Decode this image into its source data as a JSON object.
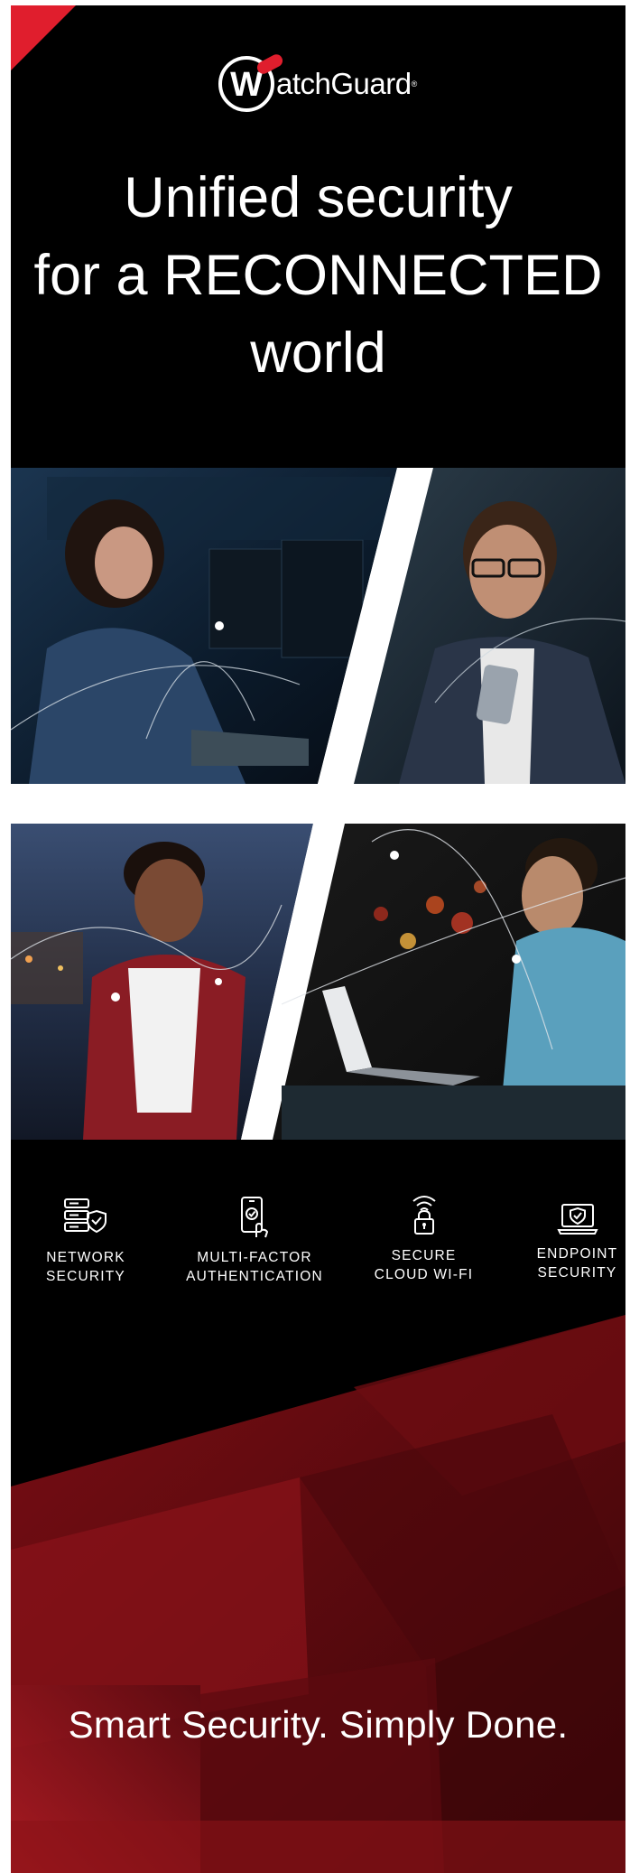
{
  "brand": {
    "logo_letter": "W",
    "logo_text": "atchGuard",
    "logo_mark": "®",
    "accent_color": "#e01e2d"
  },
  "headline": {
    "line1": "Unified security",
    "line2": "for a RECONNECTED",
    "line3": "world"
  },
  "photos": [
    {
      "icon": "woman-at-monitors-photo"
    },
    {
      "icon": "man-with-phone-photo"
    },
    {
      "icon": "woman-smiling-with-phone-photo"
    },
    {
      "icon": "man-on-laptop-photo"
    }
  ],
  "features": [
    {
      "label": "NETWORK\nSECURITY",
      "icon": "network-security-icon"
    },
    {
      "label": "MULTI-FACTOR\nAUTHENTICATION",
      "icon": "multi-factor-authentication-icon"
    },
    {
      "label": "SECURE\nCLOUD WI-FI",
      "icon": "secure-wifi-icon"
    },
    {
      "label": "ENDPOINT\nSECURITY",
      "icon": "endpoint-security-icon"
    }
  ],
  "tagline": "Smart Security. Simply Done."
}
